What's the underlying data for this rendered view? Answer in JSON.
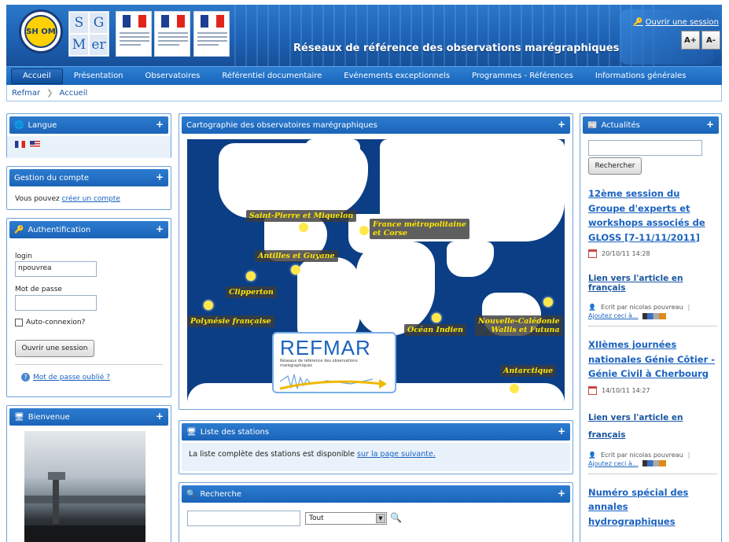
{
  "header": {
    "logo_shom": "SH OM",
    "logo_sig_letters": [
      "S",
      "G",
      "M",
      "er"
    ],
    "site_title": "Réseaux de référence des observations marégraphiques",
    "login_link": "Ouvrir une session",
    "font_bigger": "A+",
    "font_smaller": "A-"
  },
  "nav": {
    "items": [
      "Accueil",
      "Présentation",
      "Observatoires",
      "Référentiel documentaire",
      "Evénements exceptionnels",
      "Programmes - Références",
      "Informations générales"
    ]
  },
  "breadcrumb": {
    "root": "Refmar",
    "current": "Accueil"
  },
  "left": {
    "langue": {
      "title": "Langue"
    },
    "compte": {
      "title": "Gestion du compte",
      "text": "Vous pouvez ",
      "link": "créer un compte"
    },
    "auth": {
      "title": "Authentification",
      "login_label": "login",
      "login_value": "npouvrea",
      "password_label": "Mot de passe",
      "auto_label": "Auto-connexion?",
      "submit": "Ouvrir une session",
      "forgot": "Mot de passe oublié ?"
    },
    "bienvenue": {
      "title": "Bienvenue"
    }
  },
  "center": {
    "carto": {
      "title": "Cartographie des observatoires marégraphiques",
      "labels": {
        "spm": "Saint-Pierre et Miquelon",
        "france1": "France métropolitaine",
        "france2": "et Corse",
        "antilles": "Antilles et Guyane",
        "clipperton": "Clipperton",
        "polynesie": "Polynésie française",
        "ocean": "Océan Indien",
        "nc1": "Nouvelle-Calédonie",
        "nc2": "Wallis et Futuna",
        "antarctique": "Antarctique"
      },
      "refmar_logo": "REFMAR",
      "refmar_sub": "Réseaux de référence des observations marégraphiques"
    },
    "stations": {
      "title": "Liste des stations",
      "text": "La liste complète des stations est disponible ",
      "link": "sur la page suivante."
    },
    "recherche": {
      "title": "Recherche",
      "select": "Tout"
    }
  },
  "right": {
    "title": "Actualités",
    "search_button": "Rechercher",
    "articles": [
      {
        "title": "12ème session du Groupe d'experts et workshops associés de GLOSS [7-11/11/2011]",
        "date": "20/10/11 14:28",
        "link": "Lien vers l'article en français",
        "author": "Ecrit par nicolas pouvreau",
        "add": "Ajoutez ceci à..."
      },
      {
        "title": "XIIèmes journées nationales Génie Côtier - Génie Civil à Cherbourg",
        "date": "14/10/11 14:27",
        "link": "Lien vers l'article en français",
        "author": "Ecrit par nicolas pouvreau",
        "add": "Ajoutez ceci à..."
      },
      {
        "title": "Numéro spécial des annales hydrographiques"
      }
    ]
  }
}
